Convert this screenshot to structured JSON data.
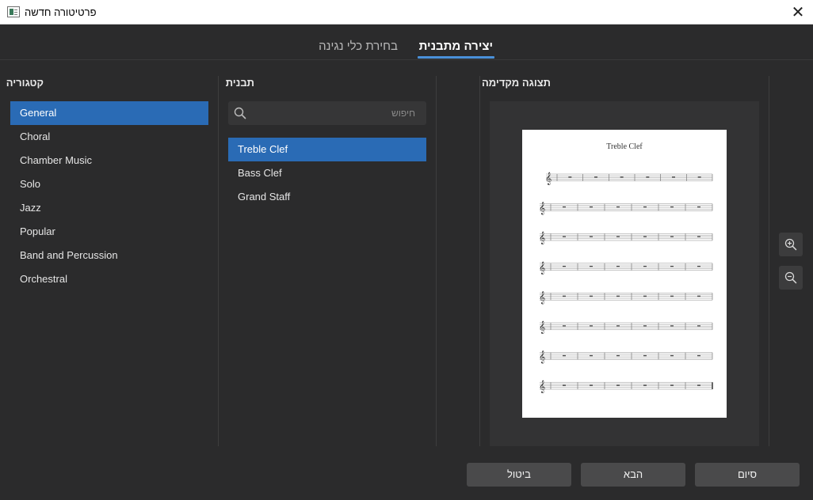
{
  "window": {
    "title": "פרטיטורה חדשה",
    "close_glyph": "✕"
  },
  "tabs": [
    {
      "label": "יצירה מתבנית",
      "active": true
    },
    {
      "label": "בחירת כלי נגינה",
      "active": false
    }
  ],
  "category": {
    "title": "קטגוריה",
    "items": [
      {
        "label": "General",
        "selected": true
      },
      {
        "label": "Choral",
        "selected": false
      },
      {
        "label": "Chamber Music",
        "selected": false
      },
      {
        "label": "Solo",
        "selected": false
      },
      {
        "label": "Jazz",
        "selected": false
      },
      {
        "label": "Popular",
        "selected": false
      },
      {
        "label": "Band and Percussion",
        "selected": false
      },
      {
        "label": "Orchestral",
        "selected": false
      }
    ]
  },
  "template": {
    "title": "תבנית",
    "search": {
      "placeholder": "חיפוש",
      "icon": "search-icon"
    },
    "items": [
      {
        "label": "Treble Clef",
        "selected": true
      },
      {
        "label": "Bass Clef",
        "selected": false
      },
      {
        "label": "Grand Staff",
        "selected": false
      }
    ]
  },
  "preview": {
    "title": "תצוגה מקדימה",
    "score_title": "Treble Clef",
    "zoom_in_icon": "zoom-in-icon",
    "zoom_out_icon": "zoom-out-icon"
  },
  "footer": {
    "cancel_label": "ביטול",
    "next_label": "הבא",
    "finish_label": "סיום"
  },
  "colors": {
    "background": "#2b2b2c",
    "selection": "#2a6bb5",
    "tab_underline": "#4a90d9",
    "button": "#4a4a4b"
  }
}
